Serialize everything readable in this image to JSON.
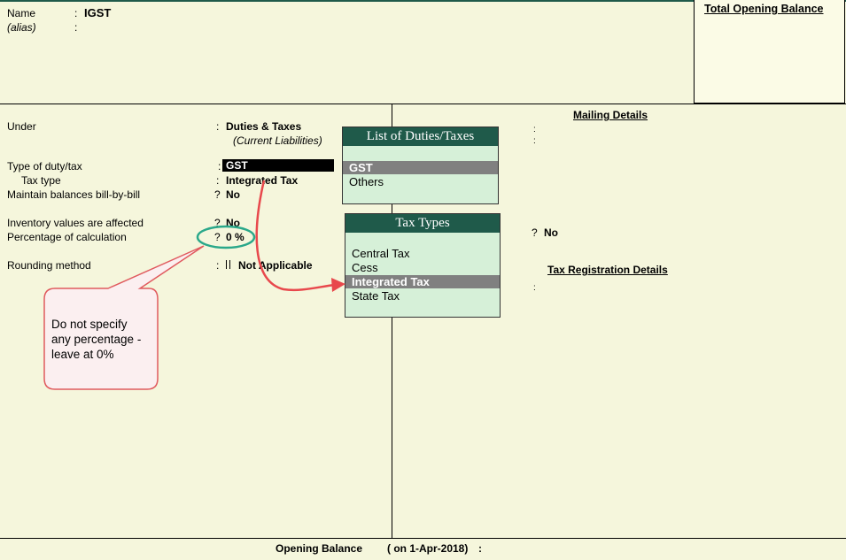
{
  "header": {
    "name_label": "Name",
    "name_value": "IGST",
    "alias_label": "(alias)",
    "total_opening_balance_label": "Total Opening Balance"
  },
  "form": {
    "under_label": "Under",
    "under_value": "Duties & Taxes",
    "under_parent": "(Current Liabilities)",
    "type_of_duty_label": "Type of duty/tax",
    "type_of_duty_value": "GST",
    "tax_type_label": "Tax type",
    "tax_type_value": "Integrated Tax",
    "maintain_bill_label": "Maintain balances bill-by-bill",
    "maintain_bill_value": "No",
    "inventory_label": "Inventory values are affected",
    "inventory_value": "No",
    "percentage_label": "Percentage of calculation",
    "percentage_value": "0 %",
    "rounding_label": "Rounding method",
    "rounding_value": "Not Applicable"
  },
  "right_panel": {
    "mailing_details_title": "Mailing Details",
    "extra_value": "No",
    "tax_registration_title": "Tax Registration Details"
  },
  "duties_popup": {
    "title": "List of Duties/Taxes",
    "items": [
      "GST",
      "Others"
    ],
    "selected": "GST"
  },
  "tax_types_popup": {
    "title": "Tax Types",
    "items": [
      "Central Tax",
      "Cess",
      "Integrated Tax",
      "State Tax"
    ],
    "selected": "Integrated Tax"
  },
  "callout": {
    "line1": "Do not specify",
    "line2": "any percentage -",
    "line3": "leave at 0%"
  },
  "footer": {
    "opening_balance_label": "Opening Balance",
    "opening_balance_date": "( on 1-Apr-2018)"
  },
  "colors": {
    "background": "#f5f6dc",
    "popup_header": "#1f5a4a",
    "popup_body": "#d6f0d8",
    "selection": "#808080",
    "highlight_circle": "#2aa88a",
    "arrow": "#e8484c"
  }
}
